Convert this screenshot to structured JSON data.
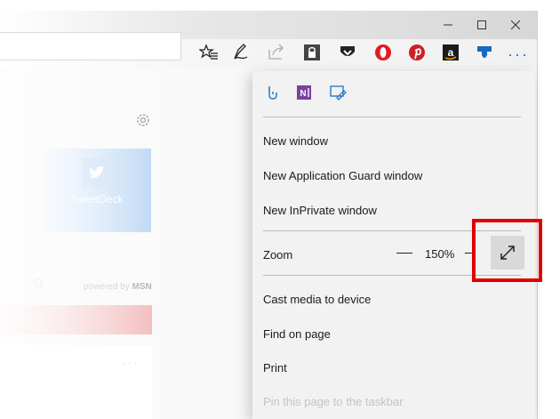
{
  "window": {
    "controls": {
      "minimize": "—",
      "maximize": "☐",
      "close": "✕"
    },
    "more_label": "···"
  },
  "toolbar": {
    "icons": [
      "favorites-star-icon",
      "pen-icon",
      "share-icon",
      "lock-icon",
      "pocket-icon",
      "opera-icon",
      "pinterest-icon",
      "amazon-icon",
      "extension-icon"
    ]
  },
  "page": {
    "tile_label": "TweetDeck",
    "powered_text": "powered by",
    "powered_brand": "MSN",
    "card_dots": "···"
  },
  "menu": {
    "items": {
      "new_window": "New window",
      "new_guard": "New Application Guard window",
      "new_inprivate": "New InPrivate window",
      "zoom_label": "Zoom",
      "zoom_value": "150%",
      "cast": "Cast media to device",
      "find": "Find on page",
      "print": "Print",
      "pin": "Pin this page to the taskbar"
    }
  },
  "colors": {
    "accent": "#2e86de",
    "highlight": "#e00000",
    "onenote": "#7b3fa0"
  }
}
